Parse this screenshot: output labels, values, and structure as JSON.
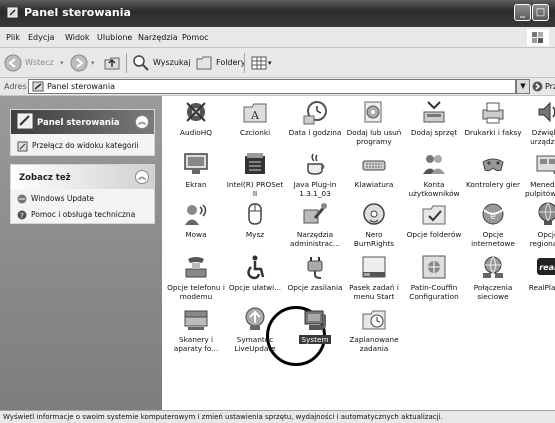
{
  "window": {
    "title": "Panel sterowania"
  },
  "menu": [
    "Plik",
    "Edycja",
    "Widok",
    "Ulubione",
    "Narzędzia",
    "Pomoc"
  ],
  "toolbar": {
    "back": "Wstecz",
    "search": "Wyszukaj",
    "folders": "Foldery"
  },
  "address": {
    "label": "Adres",
    "value": "Panel sterowania",
    "go": "Przejdź"
  },
  "left_pane": {
    "panel1": {
      "title": "Panel sterowania",
      "link": "Przełącz do widoku kategorii"
    },
    "panel2": {
      "title": "Zobacz też",
      "links": [
        "Windows Update",
        "Pomoc i obsługa techniczna"
      ]
    }
  },
  "items": [
    {
      "label": "AudioHQ",
      "icon": "audiohq-icon"
    },
    {
      "label": "Czcionki",
      "icon": "fonts-folder-icon"
    },
    {
      "label": "Data i godzina",
      "icon": "clock-icon"
    },
    {
      "label": "Dodaj lub usuń programy",
      "icon": "add-remove-programs-icon"
    },
    {
      "label": "Dodaj sprzęt",
      "icon": "add-hardware-icon"
    },
    {
      "label": "Drukarki i faksy",
      "icon": "printer-icon"
    },
    {
      "label": "Dźwięki i urządze...",
      "icon": "sound-icon"
    },
    {
      "label": "Ekran",
      "icon": "display-icon"
    },
    {
      "label": "Intel(R) PROSet II",
      "icon": "intel-proset-icon"
    },
    {
      "label": "Java Plug-in 1.3.1_03",
      "icon": "java-icon"
    },
    {
      "label": "Klawiatura",
      "icon": "keyboard-icon"
    },
    {
      "label": "Konta użytkowników",
      "icon": "users-icon"
    },
    {
      "label": "Kontrolery gier",
      "icon": "game-controller-icon"
    },
    {
      "label": "Menedżer pulpitów N...",
      "icon": "desktop-manager-icon"
    },
    {
      "label": "Mowa",
      "icon": "speech-icon"
    },
    {
      "label": "Mysz",
      "icon": "mouse-icon"
    },
    {
      "label": "Narzędzia administrac...",
      "icon": "admin-tools-icon"
    },
    {
      "label": "Nero BurnRights",
      "icon": "nero-icon"
    },
    {
      "label": "Opcje folderów",
      "icon": "folder-options-icon"
    },
    {
      "label": "Opcje internetowe",
      "icon": "internet-options-icon"
    },
    {
      "label": "Opcje regional...",
      "icon": "globe-icon"
    },
    {
      "label": "Opcje telefonu i modemu",
      "icon": "phone-modem-icon"
    },
    {
      "label": "Opcje ułatwi...",
      "icon": "accessibility-icon"
    },
    {
      "label": "Opcje zasilania",
      "icon": "power-icon"
    },
    {
      "label": "Pasek zadań i menu Start",
      "icon": "taskbar-icon"
    },
    {
      "label": "Patin-Couffin Configuration",
      "icon": "patin-couffin-icon"
    },
    {
      "label": "Połączenia sieciowe",
      "icon": "network-icon"
    },
    {
      "label": "RealPlayer",
      "icon": "realplayer-icon"
    },
    {
      "label": "Skanery i aparaty fo...",
      "icon": "scanner-icon"
    },
    {
      "label": "Symantec LiveUpdate",
      "icon": "liveupdate-icon"
    },
    {
      "label": "System",
      "icon": "system-icon",
      "selected": true
    },
    {
      "label": "Zaplanowane zadania",
      "icon": "scheduled-tasks-icon"
    }
  ],
  "status": "Wyświetl informacje o swoim systemie komputerowym i zmień ustawienia sprzętu, wydajności i automatycznych aktualizacji."
}
